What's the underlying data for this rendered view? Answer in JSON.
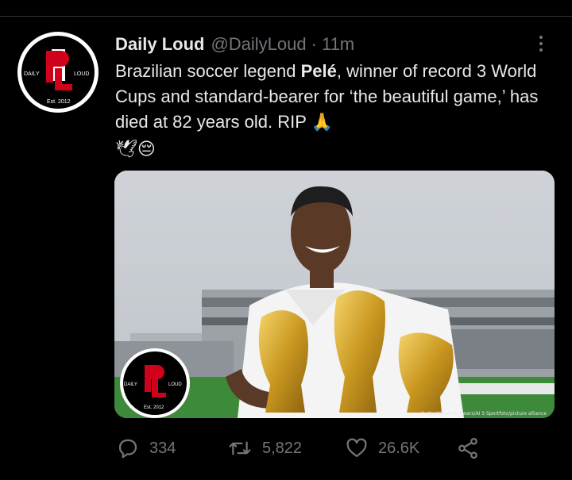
{
  "tweet": {
    "author_name": "Daily Loud",
    "author_handle": "@DailyLoud",
    "separator": "·",
    "time": "11m",
    "text_before": "Brazilian soccer legend ",
    "text_bold": "Pelé",
    "text_after": ", winner of record 3 World Cups and standard-bearer for ‘the beautiful game,’ has died at 82 years old. RIP 🙏",
    "text_emoji_line": "🕊😔"
  },
  "avatar": {
    "logo_letters": "DL",
    "logo_left": "DAILY",
    "logo_right": "LOUD",
    "logo_est": "Est. 2012"
  },
  "media": {
    "watermark_left": "DAILY",
    "watermark_right": "LOUD",
    "watermark_est": "Est. 2012",
    "credit": "© dpa/Jürgen Schwarz/AI S Sportfoto/picture alliance"
  },
  "actions": {
    "replies": "334",
    "retweets": "5,822",
    "likes": "26.6K"
  },
  "colors": {
    "background": "#000000",
    "text": "#e7e9ea",
    "secondary": "#71767b",
    "logo_red": "#d0021b"
  },
  "icons": [
    "more-icon",
    "reply-icon",
    "retweet-icon",
    "like-icon",
    "share-icon"
  ]
}
